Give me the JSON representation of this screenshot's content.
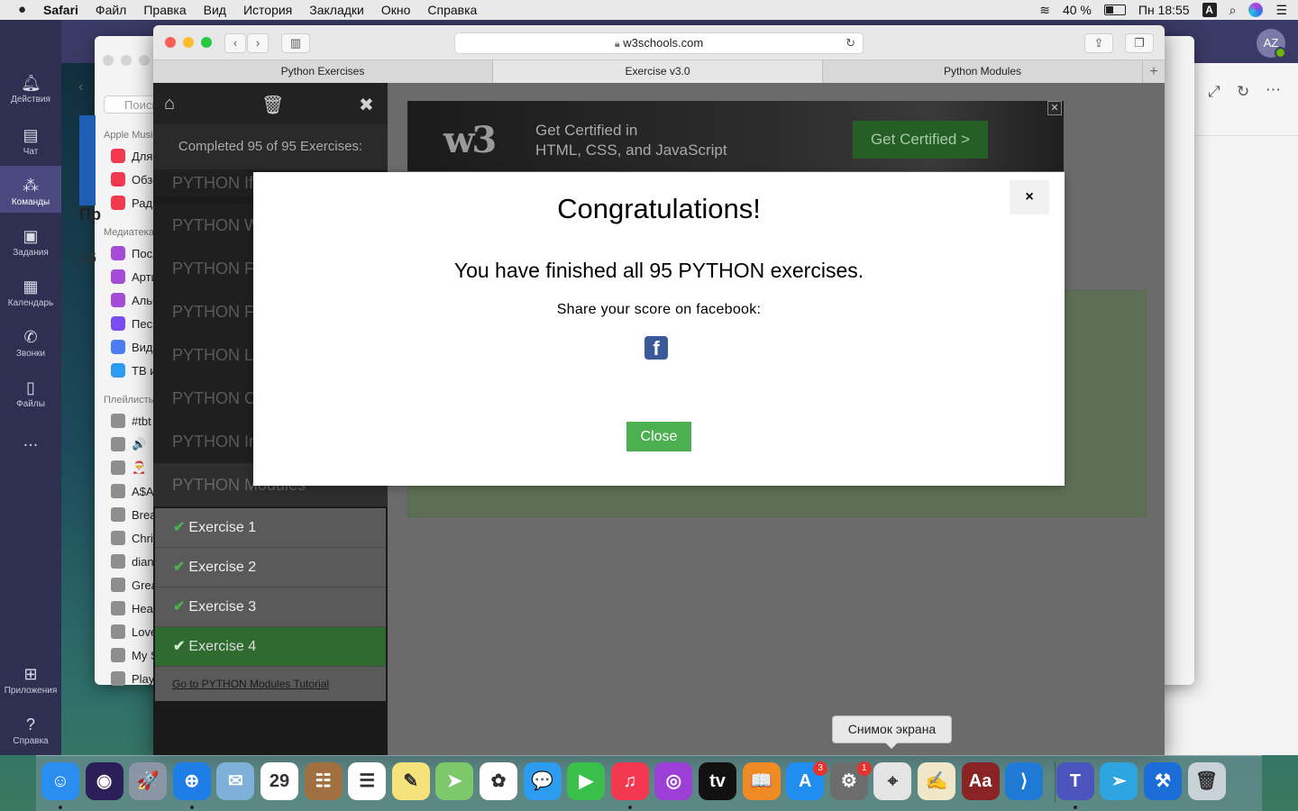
{
  "menubar": {
    "apple_icon": "apple-icon",
    "items": [
      "Safari",
      "Файл",
      "Правка",
      "Вид",
      "История",
      "Закладки",
      "Окно",
      "Справка"
    ],
    "battery": "40 %",
    "clock": "Пн 18:55",
    "input_source": "A"
  },
  "teams": {
    "nav": [
      {
        "label": "Действия",
        "icon": "bell-icon"
      },
      {
        "label": "Чат",
        "icon": "chat-icon"
      },
      {
        "label": "Команды",
        "icon": "teams-icon"
      },
      {
        "label": "Задания",
        "icon": "assignments-icon"
      },
      {
        "label": "Календарь",
        "icon": "calendar-icon"
      },
      {
        "label": "Звонки",
        "icon": "phone-icon"
      },
      {
        "label": "Файлы",
        "icon": "files-icon"
      },
      {
        "label": "...",
        "icon": "more-icon"
      }
    ],
    "apps_label": "Приложения",
    "help_label": "Справка",
    "avatar_initials": "AZ",
    "header_fragment": "Пр",
    "row_fragment": "Об"
  },
  "music": {
    "search_placeholder": "Поиск",
    "section_apple": "Apple Music",
    "apple_items": [
      {
        "label": "Для вас",
        "color": "#f2394f"
      },
      {
        "label": "Обзор",
        "color": "#f2394f"
      },
      {
        "label": "Радио",
        "color": "#f2394f"
      }
    ],
    "section_library": "Медиатека",
    "library_items": [
      {
        "label": "Последние",
        "color": "#a44cd8"
      },
      {
        "label": "Артисты",
        "color": "#a44cd8"
      },
      {
        "label": "Альбомы",
        "color": "#a44cd8"
      },
      {
        "label": "Песни",
        "color": "#7a4cf2"
      },
      {
        "label": "Видео",
        "color": "#4c7cf2"
      },
      {
        "label": "ТВ и фильмы",
        "color": "#2c9cf2"
      }
    ],
    "section_playlists": "Плейлисты",
    "playlists": [
      "#tbt",
      "🔊",
      "🎅",
      "A$AP",
      "Break",
      "Chri",
      "diana",
      "Great",
      "Hea",
      "Love",
      "My S",
      "Play"
    ]
  },
  "safari": {
    "url": "w3schools.com",
    "tabs": [
      "Python Exercises",
      "Exercise v3.0",
      "Python Modules"
    ],
    "active_tab": 1,
    "new_tab": "+"
  },
  "w3": {
    "completed": "Completed 95 of 95 Exercises:",
    "nav_sections": [
      "PYTHON If...Else",
      "PYTHON While Loops",
      "PYTHON For Loops",
      "PYTHON Functions",
      "PYTHON Lambda",
      "PYTHON Classes",
      "PYTHON Inheritance",
      "PYTHON Modules"
    ],
    "exercises": [
      "Exercise 1",
      "Exercise 2",
      "Exercise 3",
      "Exercise 4"
    ],
    "current_exercise": 4,
    "tutorial_link": "Go to PYTHON Modules Tutorial",
    "ad": {
      "logo": "w3",
      "line1": "Get Certified in",
      "line2": "HTML, CSS, and JavaScript",
      "button": "Get Certified >",
      "close": "✕"
    }
  },
  "modal": {
    "title": "Congratulations!",
    "message": "You have finished all 95 PYTHON exercises.",
    "share": "Share your score on facebook:",
    "facebook_icon": "facebook-icon",
    "close_x": "×",
    "close_button": "Close"
  },
  "tooltip": "Снимок экрана",
  "dock": {
    "apps": [
      {
        "name": "finder",
        "color": "#2a8ef0",
        "glyph": "☺",
        "badge": "",
        "dot": true
      },
      {
        "name": "siri",
        "color": "#2b1f5a",
        "glyph": "◉",
        "badge": "",
        "dot": false
      },
      {
        "name": "launchpad",
        "color": "#8a96a6",
        "glyph": "🚀",
        "badge": "",
        "dot": false
      },
      {
        "name": "safari",
        "color": "#1f7de6",
        "glyph": "⊕",
        "badge": "",
        "dot": true
      },
      {
        "name": "mail",
        "color": "#7eb0d8",
        "glyph": "✉",
        "badge": "",
        "dot": false
      },
      {
        "name": "calendar",
        "color": "#ffffff",
        "glyph": "29",
        "badge": "",
        "dot": false
      },
      {
        "name": "contacts",
        "color": "#a07040",
        "glyph": "☷",
        "badge": "",
        "dot": false
      },
      {
        "name": "reminders",
        "color": "#ffffff",
        "glyph": "☰",
        "badge": "",
        "dot": false
      },
      {
        "name": "notes",
        "color": "#f5e27a",
        "glyph": "✎",
        "badge": "",
        "dot": false
      },
      {
        "name": "maps",
        "color": "#7dc86a",
        "glyph": "➤",
        "badge": "",
        "dot": false
      },
      {
        "name": "photos",
        "color": "#ffffff",
        "glyph": "✿",
        "badge": "",
        "dot": false
      },
      {
        "name": "messages",
        "color": "#2d9cf0",
        "glyph": "💬",
        "badge": "",
        "dot": false
      },
      {
        "name": "facetime",
        "color": "#3ac04a",
        "glyph": "▶",
        "badge": "",
        "dot": false
      },
      {
        "name": "music",
        "color": "#f2394f",
        "glyph": "♫",
        "badge": "",
        "dot": true
      },
      {
        "name": "podcasts",
        "color": "#9b3fd6",
        "glyph": "◎",
        "badge": "",
        "dot": false
      },
      {
        "name": "tv",
        "color": "#111111",
        "glyph": "tv",
        "badge": "",
        "dot": false
      },
      {
        "name": "books",
        "color": "#f08a24",
        "glyph": "📖",
        "badge": "",
        "dot": false
      },
      {
        "name": "app-store",
        "color": "#1f8ef0",
        "glyph": "A",
        "badge": "3",
        "dot": false
      },
      {
        "name": "system-preferences",
        "color": "#6d6d6d",
        "glyph": "⚙",
        "badge": "1",
        "dot": false
      },
      {
        "name": "screenshot",
        "color": "#e4e4e4",
        "glyph": "⌖",
        "badge": "",
        "dot": false
      },
      {
        "name": "textedit",
        "color": "#f0e6c8",
        "glyph": "✍",
        "badge": "",
        "dot": false
      },
      {
        "name": "dictionary",
        "color": "#8a2424",
        "glyph": "Aa",
        "badge": "",
        "dot": false
      },
      {
        "name": "vscode",
        "color": "#1f7ad6",
        "glyph": "⟩",
        "badge": "",
        "dot": false
      },
      {
        "name": "teams",
        "color": "#4b53bc",
        "glyph": "T",
        "badge": "",
        "dot": true
      },
      {
        "name": "telegram",
        "color": "#2ca5e0",
        "glyph": "➢",
        "badge": "",
        "dot": false
      },
      {
        "name": "xcode",
        "color": "#1b6ed8",
        "glyph": "⚒",
        "badge": "",
        "dot": false
      },
      {
        "name": "trash",
        "color": "#c9d2d6",
        "glyph": "🗑",
        "badge": "",
        "dot": false
      }
    ]
  }
}
